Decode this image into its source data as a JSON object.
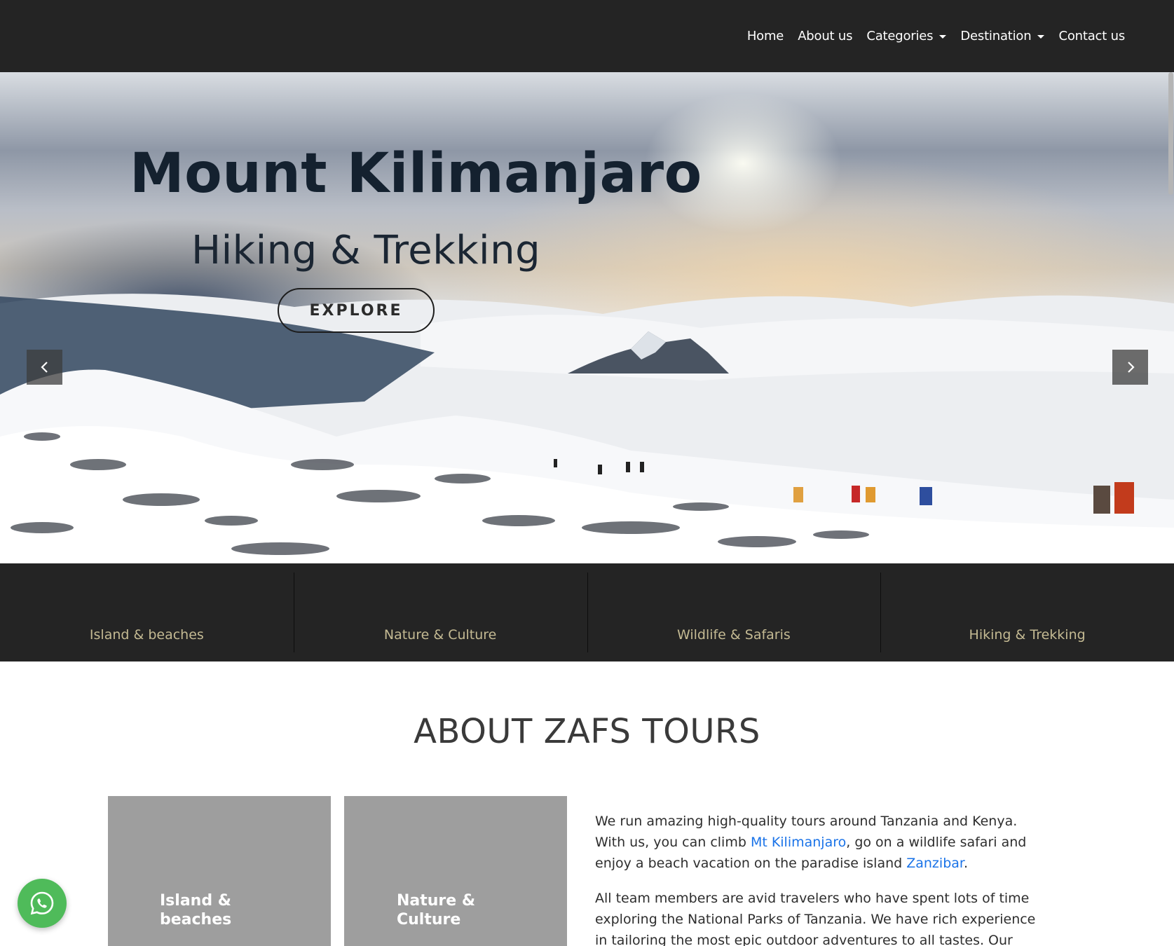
{
  "nav": {
    "items": [
      {
        "label": "Home",
        "dropdown": false
      },
      {
        "label": "About us",
        "dropdown": false
      },
      {
        "label": "Categories",
        "dropdown": true
      },
      {
        "label": "Destination",
        "dropdown": true
      },
      {
        "label": "Contact us",
        "dropdown": false
      }
    ]
  },
  "hero": {
    "title": "Mount Kilimanjaro",
    "subtitle": "Hiking & Trekking",
    "button_label": "EXPLORE",
    "prev_icon": "chevron-left-icon",
    "next_icon": "chevron-right-icon"
  },
  "categories": [
    {
      "label": "Island & beaches"
    },
    {
      "label": "Nature & Culture"
    },
    {
      "label": "Wildlife & Safaris"
    },
    {
      "label": "Hiking & Trekking"
    }
  ],
  "about": {
    "title": "ABOUT ZAFS TOURS",
    "cards": [
      {
        "line1": "Island &",
        "line2": "beaches"
      },
      {
        "line1": "Nature &",
        "line2": "Culture"
      }
    ],
    "p1_a": "We run amazing high-quality tours around Tanzania and Kenya. With us, you can climb ",
    "p1_link1": "Mt Kilimanjaro",
    "p1_b": ", go on a wildlife safari and enjoy a beach vacation on the paradise island ",
    "p1_link2": "Zanzibar",
    "p1_c": ".",
    "p2": "All team members are avid travelers who have spent lots of time exploring the National Parks of Tanzania. We have rich experience in tailoring the most epic outdoor adventures to all tastes. Our wildlife"
  },
  "colors": {
    "nav_bg": "#242424",
    "category_text": "#c4ba93",
    "link": "#1a73e8",
    "whatsapp": "#4fbb5a",
    "card_bg": "#9e9e9e"
  },
  "floating": {
    "icon": "whatsapp-icon"
  }
}
